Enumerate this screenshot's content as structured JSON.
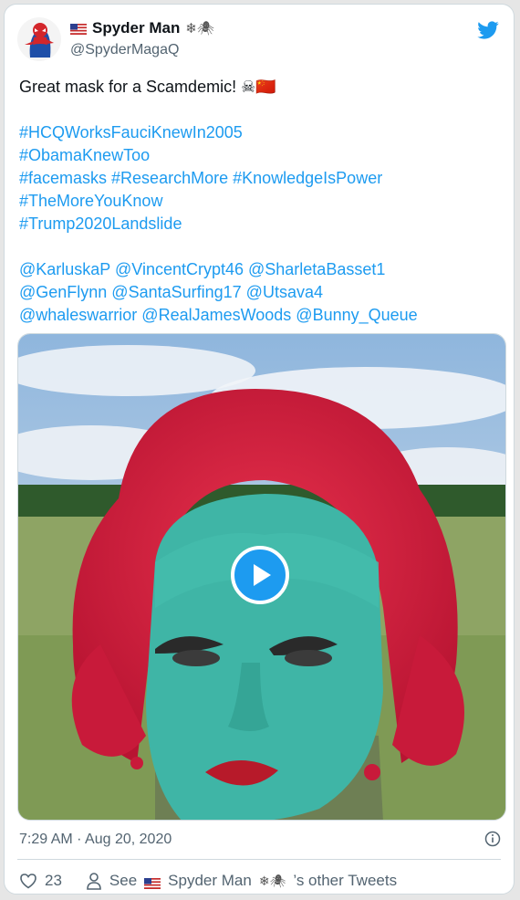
{
  "author": {
    "name": "Spyder Man",
    "handle": "@SpyderMagaQ",
    "name_emoji": "❄🕷"
  },
  "tweet": {
    "text": "Great mask for a Scamdemic!",
    "text_emoji": "☠🇨🇳",
    "hashtags": [
      "#HCQWorksFauciKnewIn2005",
      "#ObamaKnewToo",
      "#facemasks #ResearchMore #KnowledgeIsPower",
      "#TheMoreYouKnow",
      "#Trump2020Landslide"
    ],
    "mentions": [
      "@KarluskaP @VincentCrypt46 @SharletaBasset1",
      "@GenFlynn @SantaSurfing17  @Utsava4",
      "@whaleswarrior  @RealJamesWoods @Bunny_Queue"
    ],
    "timestamp": "7:29 AM · Aug 20, 2020"
  },
  "actions": {
    "likes": "23",
    "see_prefix": "See",
    "see_name": "Spyder Man",
    "see_suffix": "’s other Tweets"
  },
  "colors": {
    "link": "#1d9bf0",
    "muted": "#536471"
  }
}
